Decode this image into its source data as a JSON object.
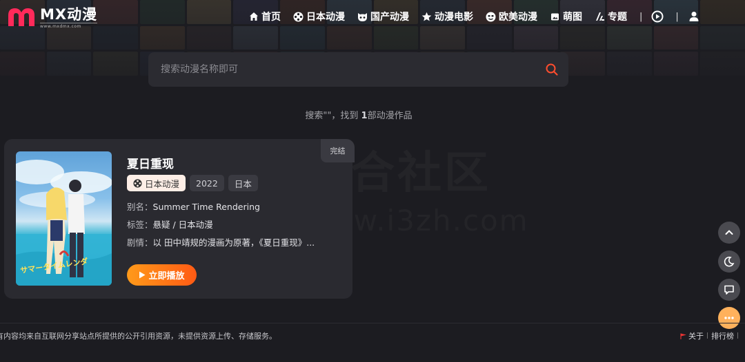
{
  "brand": {
    "title": "MX动漫",
    "subtitle": "www.mxdmx.com"
  },
  "nav": {
    "items": [
      {
        "label": "首页",
        "icon": "home-icon"
      },
      {
        "label": "日本动漫",
        "icon": "film-reel-icon"
      },
      {
        "label": "国产动漫",
        "icon": "mask-icon"
      },
      {
        "label": "动漫电影",
        "icon": "star-icon"
      },
      {
        "label": "欧美动漫",
        "icon": "smile-icon"
      },
      {
        "label": "萌图",
        "icon": "image-icon"
      },
      {
        "label": "专题",
        "icon": "topic-icon"
      }
    ],
    "separator": "|"
  },
  "search": {
    "placeholder": "搜索动漫名称即可",
    "value": ""
  },
  "result": {
    "prefix": "搜索\"\"，找到",
    "count": "1",
    "suffix": "部动漫作品"
  },
  "watermark": {
    "cn": "综合社区",
    "en": "www.i3zh.com"
  },
  "card": {
    "title": "夏日重现",
    "status": "完结",
    "chips": [
      "日本动漫",
      "2022",
      "日本"
    ],
    "alias_label": "别名：",
    "alias": "Summer Time Rendering",
    "tags_label": "标签：",
    "tags": "悬疑 / 日本动漫",
    "plot_label": "剧情：",
    "plot": "以 田中靖规的漫画为原著，《夏日重现》...",
    "play_label": "立即播放",
    "poster_text": "サマータイムレンダ"
  },
  "footer": {
    "text": "有内容均来自互联网分享站点所提供的公开引用资源，未提供资源上传、存储服务。",
    "links": [
      "关于",
      "排行榜"
    ],
    "separator": "|"
  },
  "colors": {
    "accent": "#ff5a14",
    "accent_light": "#ff9a1a",
    "background": "#1c1c21",
    "card": "#2a2a30",
    "search_icon": "#ff4d2e"
  }
}
